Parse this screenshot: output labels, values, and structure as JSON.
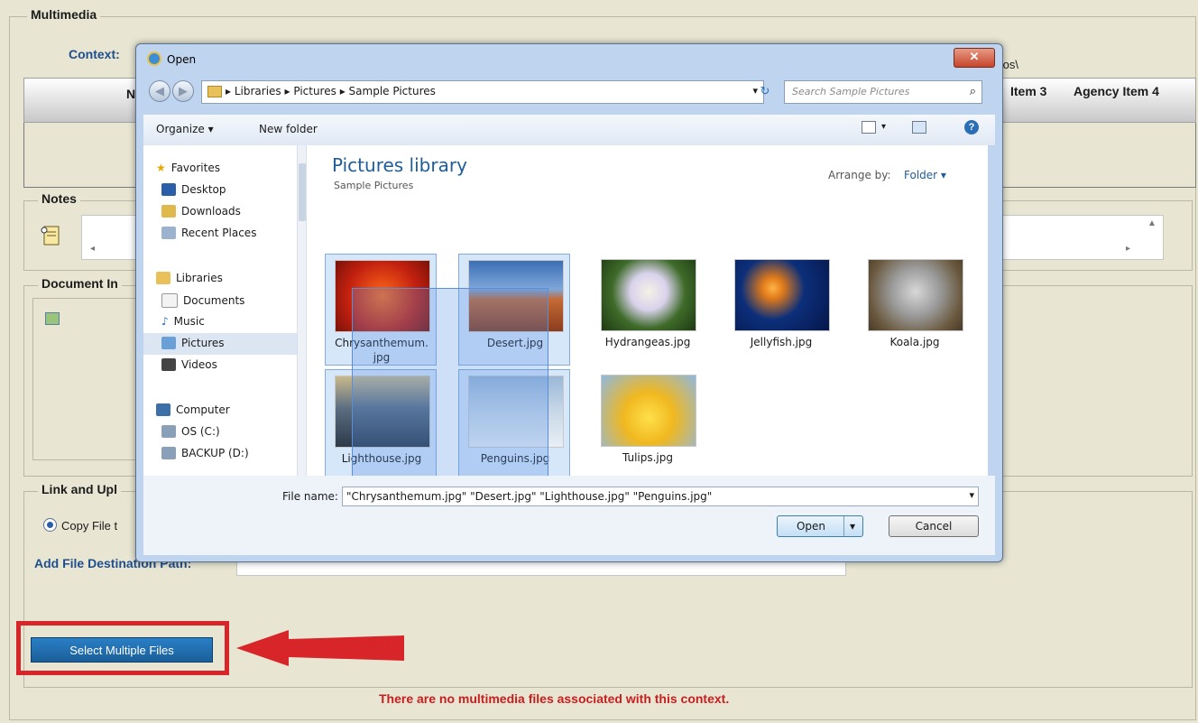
{
  "multimedia": {
    "legend": "Multimedia",
    "context_label": "Context:",
    "root_dir_partial": "Root Dir   F:\\[MULTISERVER]\\  \\Multimedia\\Sample Photos\\",
    "path_suffix": "tos\\"
  },
  "table": {
    "col_partial": "N",
    "col_item3": "Item 3",
    "col_agency_item4": "Agency Item 4"
  },
  "notes": {
    "legend": "Notes"
  },
  "document": {
    "legend_partial": "Document In"
  },
  "link_upload": {
    "legend_partial": "Link and Upl",
    "radio_label_partial": "Copy File t",
    "dest_label": "Add File Destination Path:",
    "dest_value": ""
  },
  "select_button": "Select Multiple Files",
  "no_files_msg": "There are no multimedia files associated with this context.",
  "dialog": {
    "title": "Open",
    "breadcrumb": [
      "Libraries",
      "Pictures",
      "Sample Pictures"
    ],
    "search_placeholder": "Search Sample Pictures",
    "organize": "Organize ▾",
    "new_folder": "New folder",
    "library_title": "Pictures library",
    "library_sub": "Sample Pictures",
    "arrange_label": "Arrange by:",
    "arrange_value": "Folder ▾",
    "nav": {
      "favorites": "Favorites",
      "desktop": "Desktop",
      "downloads": "Downloads",
      "recent": "Recent Places",
      "libraries": "Libraries",
      "documents": "Documents",
      "music": "Music",
      "pictures": "Pictures",
      "videos": "Videos",
      "computer": "Computer",
      "os": "OS (C:)",
      "backup": "BACKUP (D:)"
    },
    "files": [
      {
        "name": "Chrysanthemum.\njpg",
        "selected": true
      },
      {
        "name": "Desert.jpg",
        "selected": true
      },
      {
        "name": "Hydrangeas.jpg",
        "selected": false
      },
      {
        "name": "Jellyfish.jpg",
        "selected": false
      },
      {
        "name": "Koala.jpg",
        "selected": false
      },
      {
        "name": "Lighthouse.jpg",
        "selected": true
      },
      {
        "name": "Penguins.jpg",
        "selected": true
      },
      {
        "name": "Tulips.jpg",
        "selected": false
      }
    ],
    "file_name_label": "File name:",
    "file_name_value": "\"Chrysanthemum.jpg\" \"Desert.jpg\" \"Lighthouse.jpg\" \"Penguins.jpg\"",
    "open_button": "Open",
    "cancel_button": "Cancel"
  },
  "colors": {
    "accent_red": "#d8252a",
    "button_blue": "#1f6fb2",
    "page_bg": "#e8e6d3"
  }
}
